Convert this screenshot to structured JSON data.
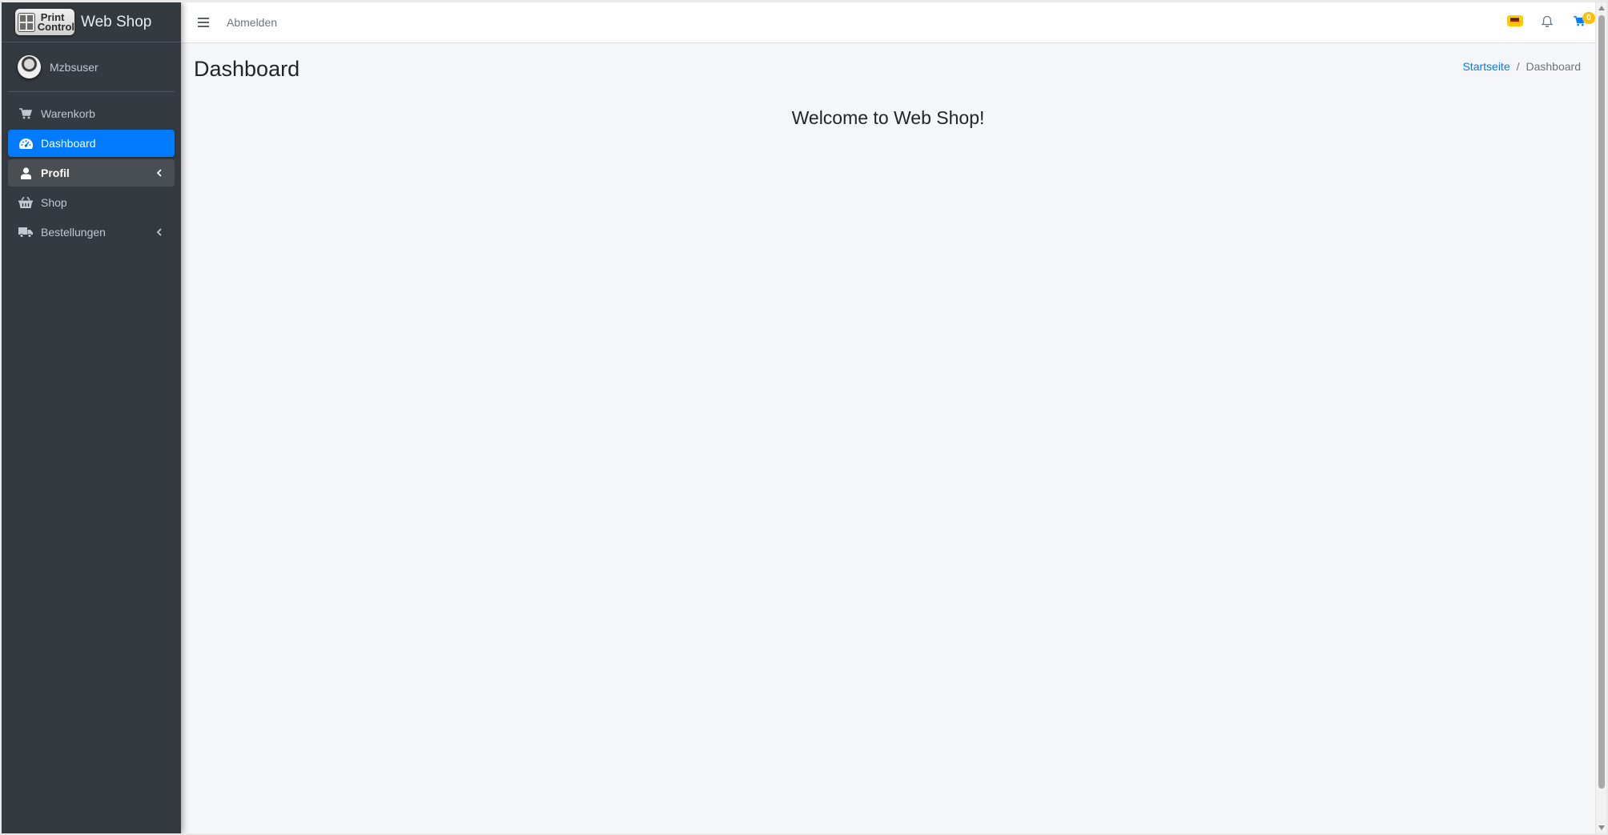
{
  "brand": {
    "logo_line1": "Print",
    "logo_line2": "Control",
    "title": "Web Shop"
  },
  "user": {
    "name": "Mzbsuser"
  },
  "sidebar": {
    "items": [
      {
        "label": "Warenkorb",
        "icon": "shopping-cart-icon"
      },
      {
        "label": "Dashboard",
        "icon": "tachometer-icon",
        "active": true
      },
      {
        "label": "Profil",
        "icon": "user-icon",
        "expandable": true,
        "open": true
      },
      {
        "label": "Shop",
        "icon": "basket-icon"
      },
      {
        "label": "Bestellungen",
        "icon": "truck-icon",
        "expandable": true
      }
    ]
  },
  "navbar": {
    "logout_label": "Abmelden",
    "language_icon": "german-flag-icon",
    "notifications_icon": "bell-icon",
    "cart_icon": "cart-icon",
    "cart_count": "0"
  },
  "content": {
    "page_title": "Dashboard",
    "breadcrumb": {
      "home": "Startseite",
      "separator": "/",
      "current": "Dashboard"
    },
    "welcome": "Welcome to Web Shop!"
  },
  "colors": {
    "sidebar_bg": "#343a40",
    "active_item": "#007bff",
    "content_bg": "#f4f6f9",
    "badge": "#ffc107",
    "link": "#007bff"
  }
}
